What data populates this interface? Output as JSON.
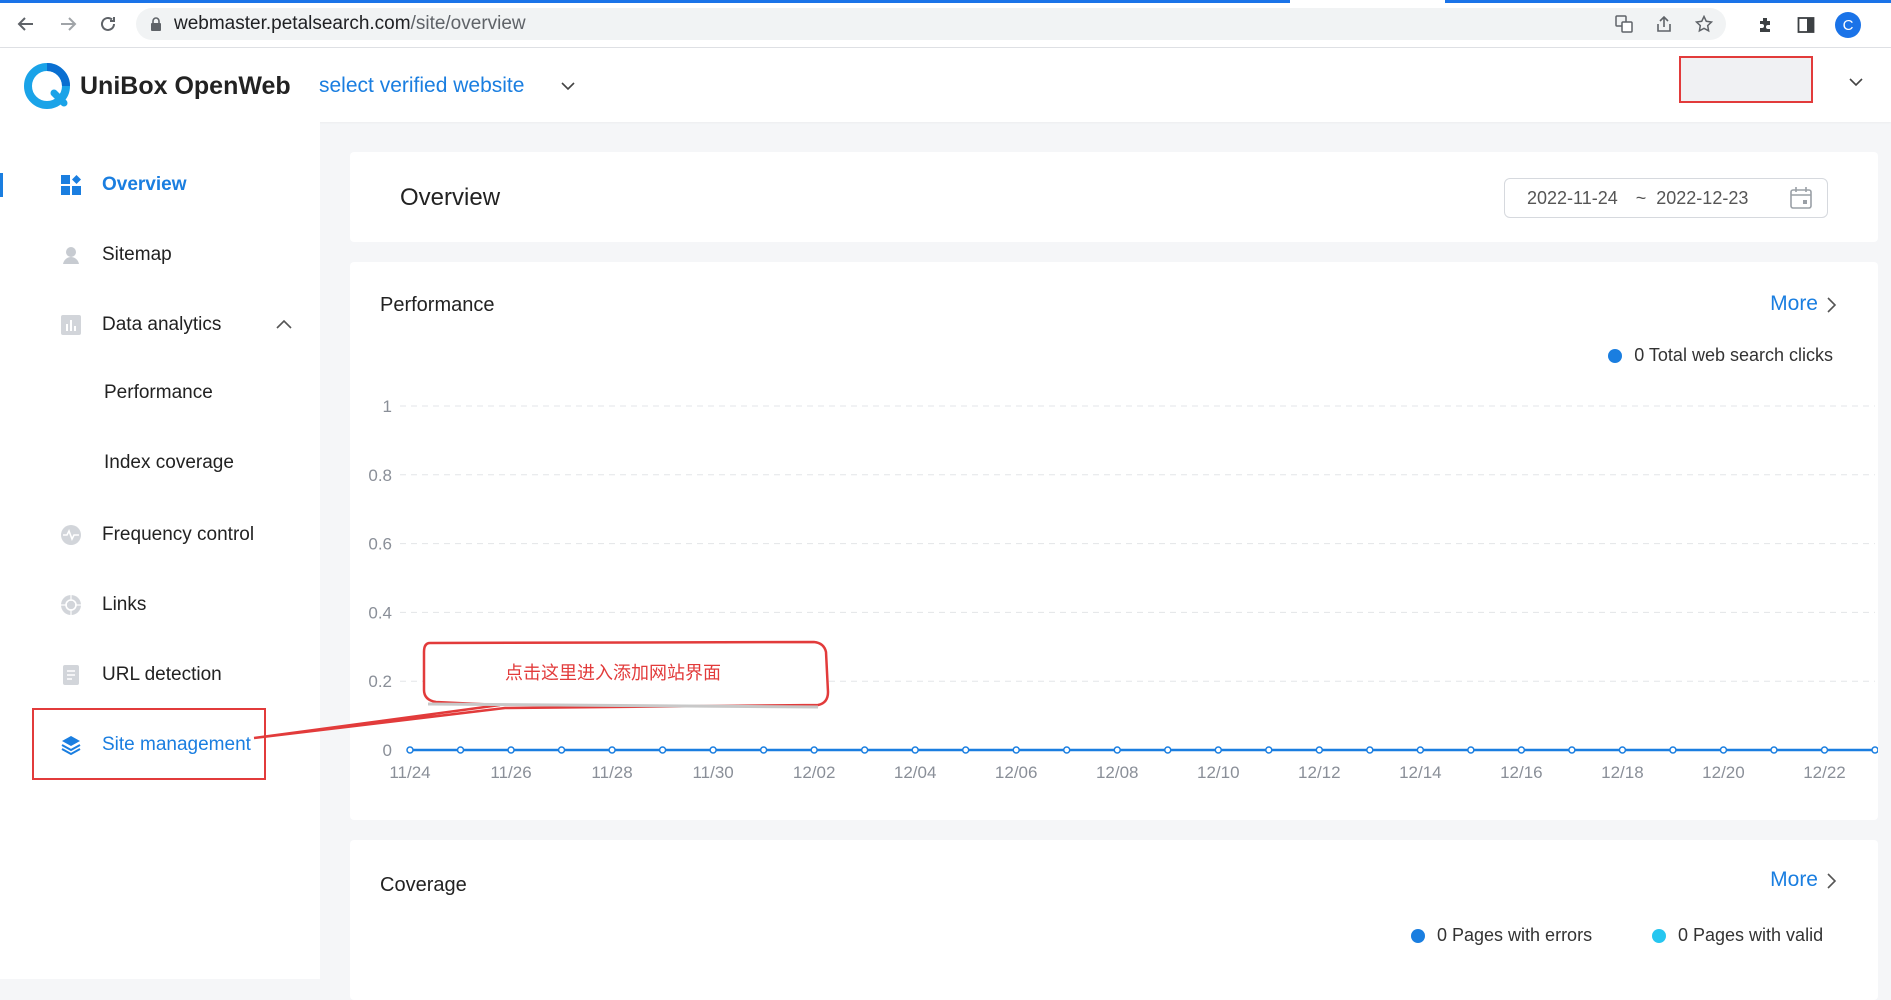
{
  "browser": {
    "url_host": "webmaster.petalsearch.com",
    "url_path": "/site/overview",
    "avatar_letter": "C",
    "icons": [
      "back-icon",
      "forward-icon",
      "reload-icon",
      "lock-icon",
      "translate-icon",
      "share-icon",
      "star-icon",
      "extensions-icon",
      "side-panel-icon"
    ]
  },
  "header": {
    "brand": "UniBox OpenWeb",
    "site_select": "select verified website",
    "accent": "#1a7ee0"
  },
  "sidebar": {
    "items": [
      {
        "label": "Overview",
        "icon": "dashboard-icon",
        "active": true
      },
      {
        "label": "Sitemap",
        "icon": "sitemap-icon"
      },
      {
        "label": "Data analytics",
        "icon": "bar-chart-icon",
        "expanded": true
      },
      {
        "label": "Performance",
        "sub": true
      },
      {
        "label": "Index coverage",
        "sub": true
      },
      {
        "label": "Frequency control",
        "icon": "pulse-icon"
      },
      {
        "label": "Links",
        "icon": "link-icon"
      },
      {
        "label": "URL detection",
        "icon": "document-icon"
      },
      {
        "label": "Site management",
        "icon": "layers-icon"
      }
    ]
  },
  "overview": {
    "title": "Overview",
    "date_start": "2022-11-24",
    "date_sep": "~",
    "date_end": "2022-12-23"
  },
  "performance": {
    "title": "Performance",
    "more": "More",
    "legend": "0 Total web search clicks"
  },
  "coverage": {
    "title": "Coverage",
    "more": "More",
    "legend_errors": "0 Pages with errors",
    "legend_valid": "0 Pages with valid"
  },
  "annotation": {
    "text": "点击这里进入添加网站界面",
    "color": "#e23b3b"
  },
  "chart_data": {
    "type": "line",
    "x_tick_labels": [
      "11/24",
      "11/26",
      "11/28",
      "11/30",
      "12/02",
      "12/04",
      "12/06",
      "12/08",
      "12/10",
      "12/12",
      "12/14",
      "12/16",
      "12/18",
      "12/20",
      "12/22"
    ],
    "y_tick_labels": [
      "0",
      "0.2",
      "0.4",
      "0.6",
      "0.8",
      "1"
    ],
    "ylim": [
      0,
      1
    ],
    "grid": true,
    "legend_position": "top-right",
    "series": [
      {
        "name": "0 Total web search clicks",
        "color": "#1a7ee0",
        "x": [
          "11/24",
          "11/25",
          "11/26",
          "11/27",
          "11/28",
          "11/29",
          "11/30",
          "12/01",
          "12/02",
          "12/03",
          "12/04",
          "12/05",
          "12/06",
          "12/07",
          "12/08",
          "12/09",
          "12/10",
          "12/11",
          "12/12",
          "12/13",
          "12/14",
          "12/15",
          "12/16",
          "12/17",
          "12/18",
          "12/19",
          "12/20",
          "12/21",
          "12/22",
          "12/23"
        ],
        "values": [
          0,
          0,
          0,
          0,
          0,
          0,
          0,
          0,
          0,
          0,
          0,
          0,
          0,
          0,
          0,
          0,
          0,
          0,
          0,
          0,
          0,
          0,
          0,
          0,
          0,
          0,
          0,
          0,
          0,
          0
        ]
      }
    ]
  }
}
